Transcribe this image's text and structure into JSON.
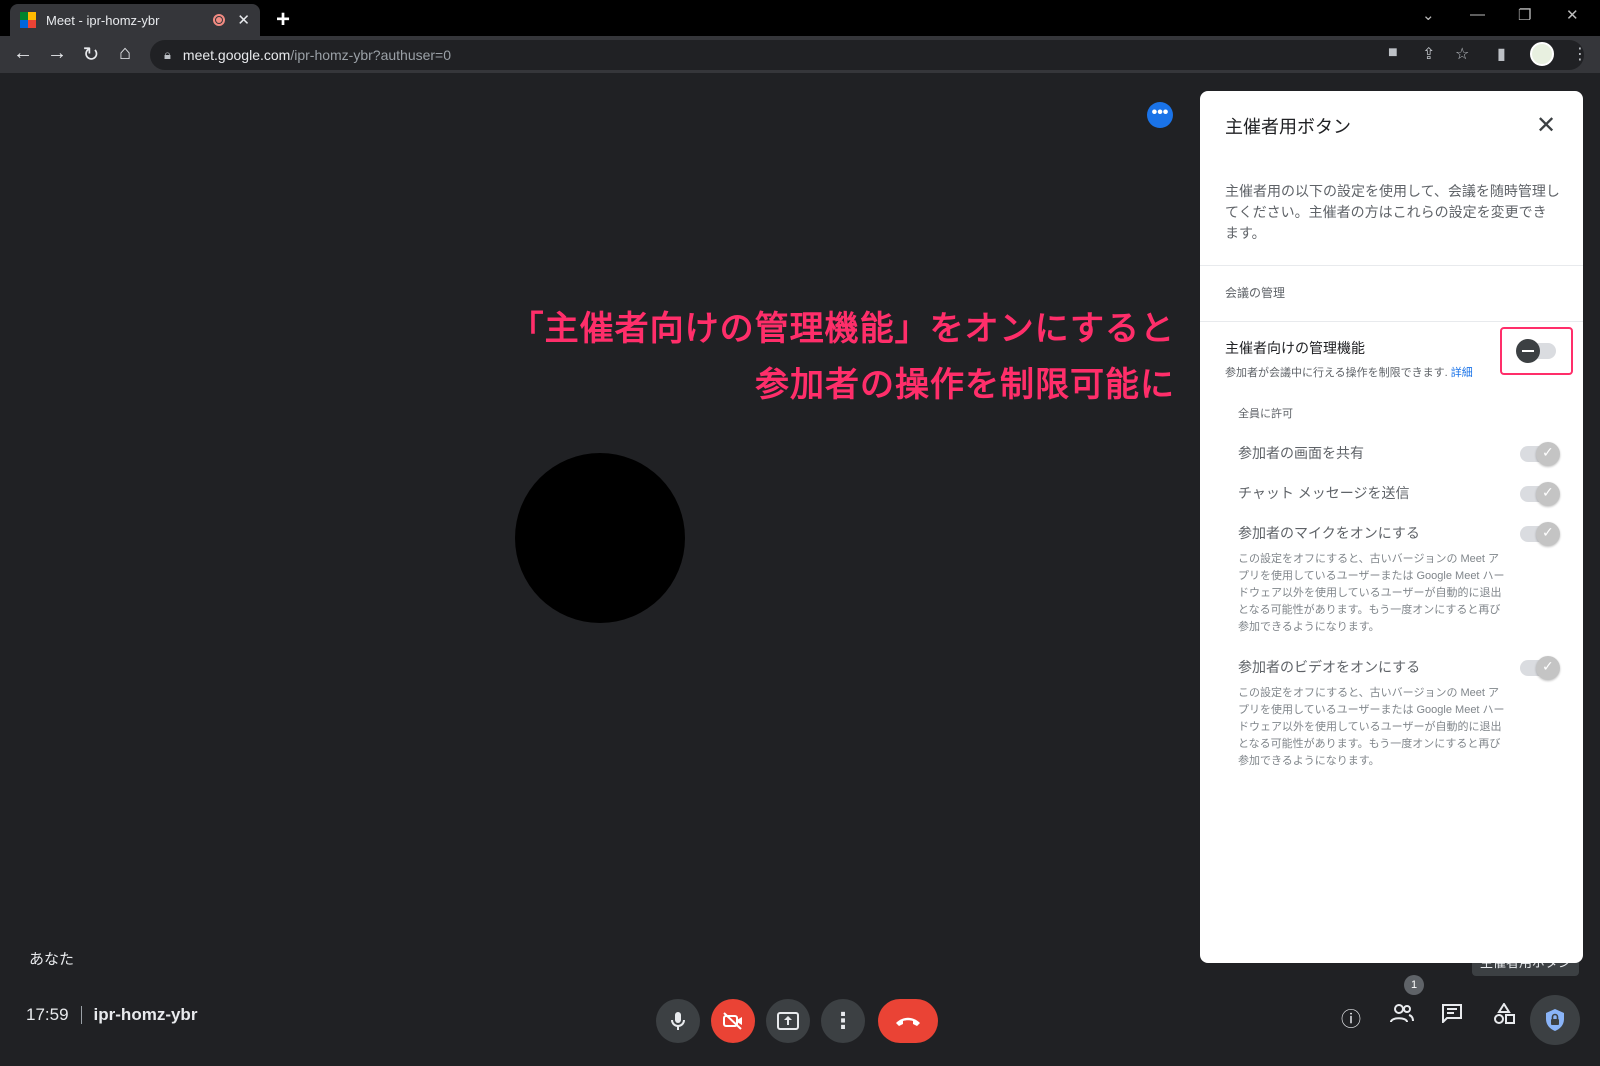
{
  "browser": {
    "tab_title": "Meet - ipr-homz-ybr",
    "tab_close": "✕",
    "new_tab": "+",
    "url_host": "meet.google.com",
    "url_path": "/ipr-homz-ybr?authuser=0"
  },
  "meet": {
    "more_label": "•••",
    "self_label": "あなた",
    "time": "17:59",
    "meeting_code": "ipr-homz-ybr",
    "participant_count": "1",
    "tooltip": "主催者用ボタン"
  },
  "annotation": {
    "line1": "「主催者向けの管理機能」をオンにすると",
    "line2": "参加者の操作を制限可能に",
    "color": "#ff2e6a"
  },
  "panel": {
    "title": "主催者用ボタン",
    "description": "主催者用の以下の設定を使用して、会議を随時管理してください。主催者の方はこれらの設定を変更できます。",
    "section": "会議の管理",
    "host_mgmt_label": "主催者向けの管理機能",
    "host_mgmt_sub": "参加者が会議中に行える操作を制限できます.",
    "host_mgmt_link": "詳細",
    "host_mgmt_on": false,
    "allow_all_label": "全員に許可",
    "options": [
      {
        "label": "参加者の画面を共有",
        "on": true
      },
      {
        "label": "チャット メッセージを送信",
        "on": true
      },
      {
        "label": "参加者のマイクをオンにする",
        "on": true,
        "note": "この設定をオフにすると、古いバージョンの Meet アプリを使用しているユーザーまたは Google Meet ハードウェア以外を使用しているユーザーが自動的に退出となる可能性があります。もう一度オンにすると再び参加できるようになります。"
      },
      {
        "label": "参加者のビデオをオンにする",
        "on": true,
        "note": "この設定をオフにすると、古いバージョンの Meet アプリを使用しているユーザーまたは Google Meet ハードウェア以外を使用しているユーザーが自動的に退出となる可能性があります。もう一度オンにすると再び参加できるようになります。"
      }
    ]
  },
  "icons": {
    "back": "back-arrow-icon",
    "forward": "forward-arrow-icon",
    "reload": "reload-icon",
    "home": "home-icon",
    "mic": "mic-icon",
    "camera_off": "camera-off-icon",
    "present": "present-icon",
    "more": "more-vert-icon",
    "hangup": "hangup-icon",
    "info": "info-icon",
    "people": "people-icon",
    "chat": "chat-icon",
    "activities": "activities-icon",
    "host_controls": "shield-lock-icon"
  }
}
